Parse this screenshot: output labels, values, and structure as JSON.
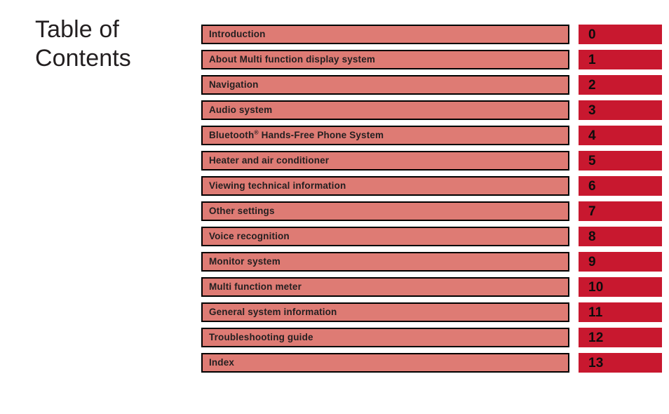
{
  "page": {
    "title": "Table of\nContents",
    "background_color": "#ffffff",
    "title_color": "#231f20"
  },
  "colors": {
    "bar_fill": "#de7b74",
    "bar_border": "#000000",
    "number_box_fill": "#c8182f",
    "label_text": "#231f20",
    "number_text": "#0d0d0d"
  },
  "contents": {
    "rows": [
      {
        "label": "Introduction",
        "label_prefix": "",
        "superscript": "",
        "label_suffix": "",
        "number": "0"
      },
      {
        "label": "About Multi function display system",
        "label_prefix": "",
        "superscript": "",
        "label_suffix": "",
        "number": "1"
      },
      {
        "label": "Navigation",
        "label_prefix": "",
        "superscript": "",
        "label_suffix": "",
        "number": "2"
      },
      {
        "label": "Audio system",
        "label_prefix": "",
        "superscript": "",
        "label_suffix": "",
        "number": "3"
      },
      {
        "label": "Bluetooth® Hands-Free Phone System",
        "label_prefix": "Bluetooth",
        "superscript": "®",
        "label_suffix": " Hands-Free Phone System",
        "number": "4"
      },
      {
        "label": "Heater and air conditioner",
        "label_prefix": "",
        "superscript": "",
        "label_suffix": "",
        "number": "5"
      },
      {
        "label": "Viewing technical information",
        "label_prefix": "",
        "superscript": "",
        "label_suffix": "",
        "number": "6"
      },
      {
        "label": "Other settings",
        "label_prefix": "",
        "superscript": "",
        "label_suffix": "",
        "number": "7"
      },
      {
        "label": "Voice recognition",
        "label_prefix": "",
        "superscript": "",
        "label_suffix": "",
        "number": "8"
      },
      {
        "label": "Monitor system",
        "label_prefix": "",
        "superscript": "",
        "label_suffix": "",
        "number": "9"
      },
      {
        "label": "Multi function meter",
        "label_prefix": "",
        "superscript": "",
        "label_suffix": "",
        "number": "10"
      },
      {
        "label": "General system information",
        "label_prefix": "",
        "superscript": "",
        "label_suffix": "",
        "number": "11"
      },
      {
        "label": "Troubleshooting guide",
        "label_prefix": "",
        "superscript": "",
        "label_suffix": "",
        "number": "12"
      },
      {
        "label": "Index",
        "label_prefix": "",
        "superscript": "",
        "label_suffix": "",
        "number": "13"
      }
    ]
  }
}
